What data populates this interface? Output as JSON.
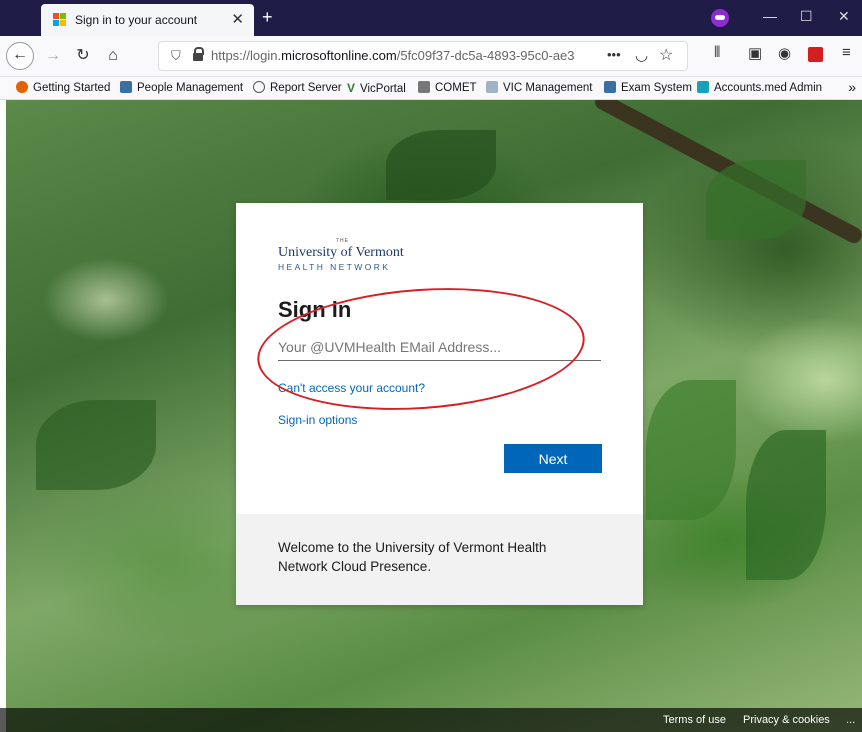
{
  "browser": {
    "tab_title": "Sign in to your account",
    "new_tab_label": "+",
    "url_prefix": "https://login.",
    "url_domain": "microsoftonline.com",
    "url_rest": "/5fc09f37-dc5a-4893-95c0-ae3",
    "url_more": "•••"
  },
  "bookmarks": [
    {
      "label": "Getting Started",
      "icon": "firefox-icon",
      "color": "#e66000"
    },
    {
      "label": "People Management",
      "icon": "people-icon",
      "color": "#3a6ea5"
    },
    {
      "label": "Report Server",
      "icon": "globe-icon",
      "color": "#555555"
    },
    {
      "label": "VicPortal",
      "icon": "v-icon",
      "color": "#2e7d32"
    },
    {
      "label": "COMET",
      "icon": "comet-icon",
      "color": "#777777"
    },
    {
      "label": "VIC Management",
      "icon": "doc-icon",
      "color": "#9fb3c8"
    },
    {
      "label": "Exam System",
      "icon": "people-icon",
      "color": "#3a6ea5"
    },
    {
      "label": "Accounts.med Admin",
      "icon": "admin-icon",
      "color": "#17a2b8"
    }
  ],
  "signin": {
    "logo_top": "University of Vermont",
    "logo_bottom": "HEALTH NETWORK",
    "logo_the": "THE",
    "title": "Sign in",
    "email_placeholder": "Your @UVMHealth EMail Address...",
    "cant_access": "Can't access your account?",
    "signin_options": "Sign-in options",
    "next_label": "Next",
    "welcome": "Welcome to the University of Vermont Health Network Cloud Presence."
  },
  "footer": {
    "terms": "Terms of use",
    "privacy": "Privacy & cookies",
    "more": "..."
  },
  "colors": {
    "accent": "#0067b8",
    "annotation": "#d81f26"
  }
}
